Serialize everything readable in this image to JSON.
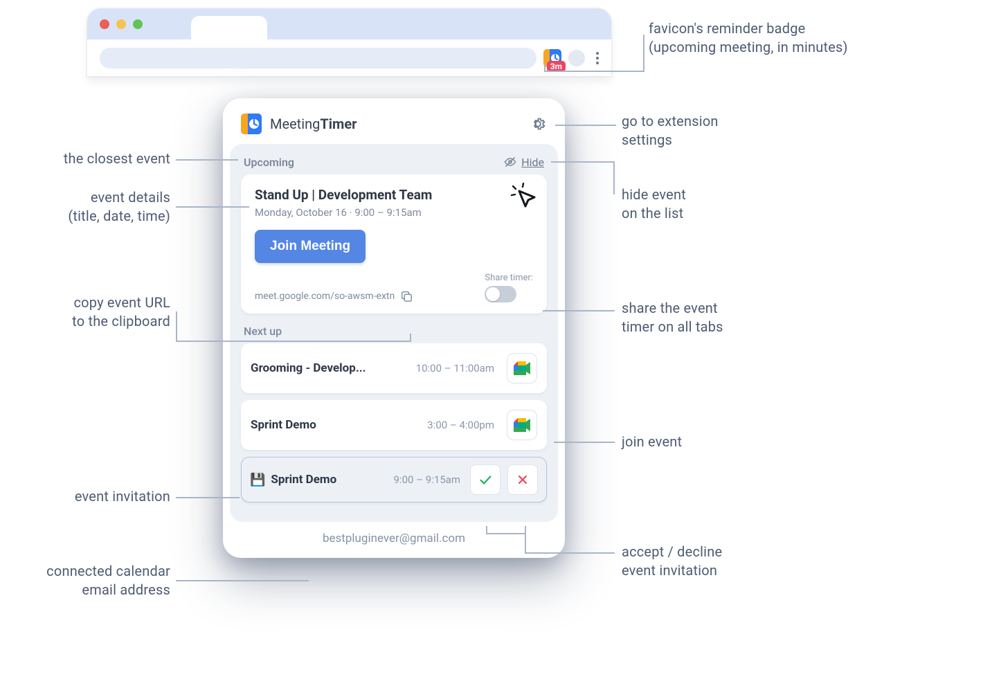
{
  "browser": {
    "favicon_badge": "3m"
  },
  "annotations": {
    "favicon_badge": "favicon's reminder badge\n(upcoming meeting, in minutes)",
    "settings": "go to extension\nsettings",
    "closest_event": "the closest event",
    "event_details": "event details\n(title, date, time)",
    "hide_event": "hide event\non the list",
    "copy_url": "copy event URL\nto the clipboard",
    "share_timer": "share the event\ntimer on all tabs",
    "join_event": "join event",
    "invitation": "event invitation",
    "accept_decline": "accept / decline\nevent invitation",
    "email": "connected calendar\nemail address"
  },
  "popup": {
    "app_name_1": "Meeting",
    "app_name_2": "Timer",
    "upcoming_label": "Upcoming",
    "hide_label": "Hide",
    "event": {
      "title": "Stand Up | Development Team",
      "subtitle": "Monday, October 16  ·  9:00 – 9:15am",
      "join_label": "Join Meeting",
      "url": "meet.google.com/so-awsm-extn",
      "share_label": "Share timer:"
    },
    "next_label": "Next up",
    "next": [
      {
        "title": "Grooming - Develop...",
        "time": "10:00 – 11:00am"
      },
      {
        "title": "Sprint Demo",
        "time": "3:00 – 4:00pm"
      }
    ],
    "invite": {
      "title": "Sprint Demo",
      "time": "9:00 – 9:15am"
    },
    "email": "bestpluginever@gmail.com"
  }
}
